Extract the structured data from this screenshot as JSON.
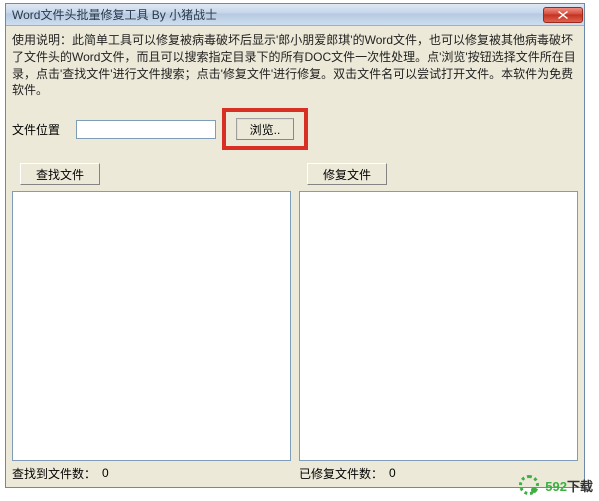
{
  "window": {
    "title": "Word文件头批量修复工具  By 小猪战士"
  },
  "instructions": "使用说明：此简单工具可以修复被病毒破坏后显示'郎小朋爱郎琪'的Word文件，也可以修复被其他病毒破坏了文件头的Word文件，而且可以搜索指定目录下的所有DOC文件一次性处理。点'浏览'按钮选择文件所在目录，点击'查找文件'进行文件搜索；点击'修复文件'进行修复。双击文件名可以尝试打开文件。本软件为免费软件。",
  "file": {
    "label": "文件位置",
    "value": "",
    "browse_label": "浏览.."
  },
  "left_panel": {
    "button_label": "查找文件",
    "status_label": "查找到文件数：",
    "count": "0"
  },
  "right_panel": {
    "button_label": "修复文件",
    "status_label": "已修复文件数：",
    "count": "0"
  },
  "watermark": {
    "text_green": "592",
    "text_black": "下载"
  }
}
